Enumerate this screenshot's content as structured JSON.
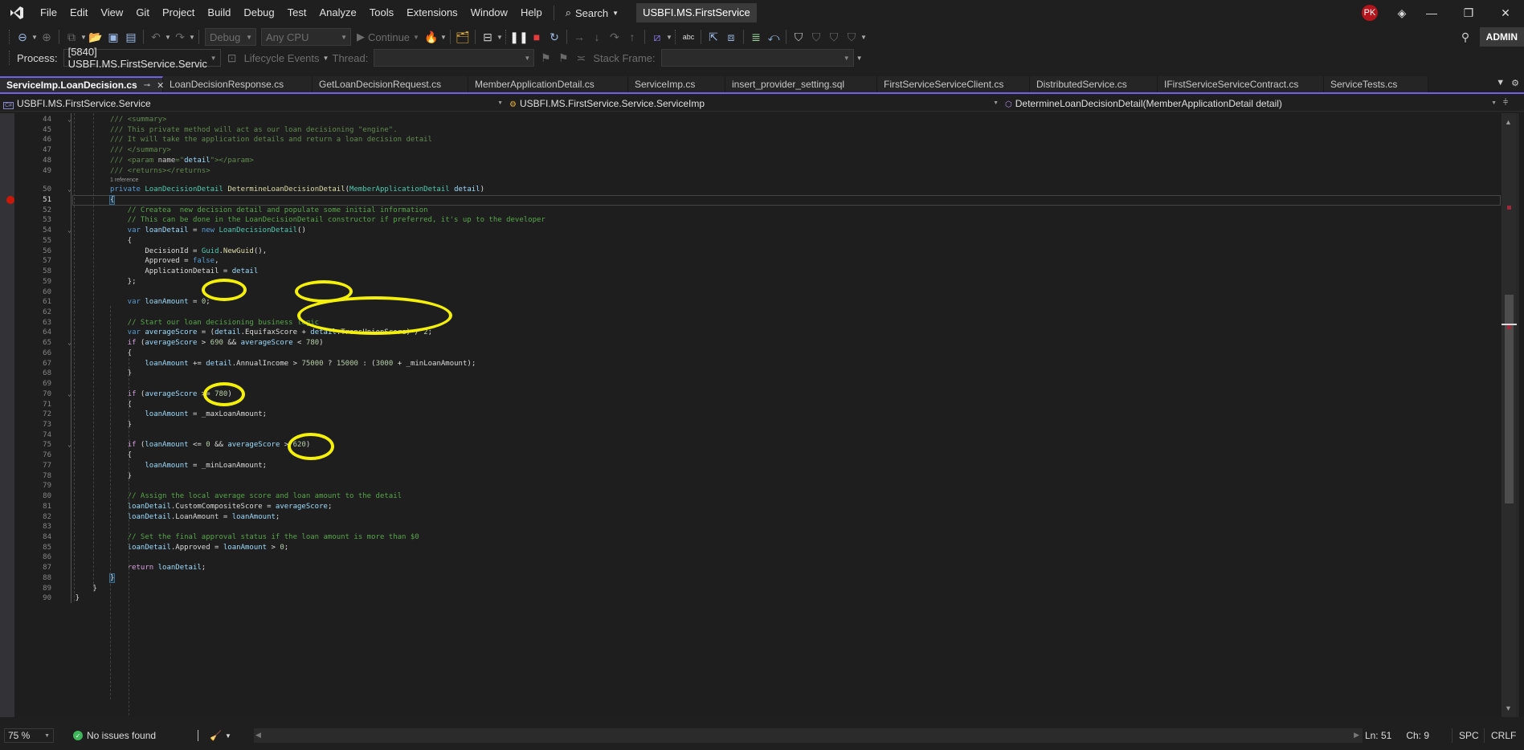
{
  "menubar": {
    "items": [
      "File",
      "Edit",
      "View",
      "Git",
      "Project",
      "Build",
      "Debug",
      "Test",
      "Analyze",
      "Tools",
      "Extensions",
      "Window",
      "Help"
    ],
    "search_label": "Search",
    "solution_name": "USBFI.MS.FirstService",
    "user_initials": "PK"
  },
  "toolbar": {
    "config": "Debug",
    "platform": "Any CPU",
    "continue_label": "Continue",
    "admin_label": "ADMIN"
  },
  "debugbar": {
    "process_label": "Process:",
    "process_value": "[5840] USBFI.MS.FirstService.Servic",
    "lifecycle_label": "Lifecycle Events",
    "thread_label": "Thread:",
    "thread_value": "",
    "stack_frame_label": "Stack Frame:",
    "stack_frame_value": ""
  },
  "tabs": [
    {
      "label": "ServiceImp.LoanDecision.cs",
      "active": true
    },
    {
      "label": "LoanDecisionResponse.cs"
    },
    {
      "label": "GetLoanDecisionRequest.cs"
    },
    {
      "label": "MemberApplicationDetail.cs"
    },
    {
      "label": "ServiceImp.cs"
    },
    {
      "label": "insert_provider_setting.sql"
    },
    {
      "label": "FirstServiceServiceClient.cs"
    },
    {
      "label": "DistributedService.cs"
    },
    {
      "label": "IFirstServiceServiceContract.cs"
    },
    {
      "label": "ServiceTests.cs"
    }
  ],
  "navbar": {
    "project": "USBFI.MS.FirstService.Service",
    "type": "USBFI.MS.FirstService.Service.ServiceImp",
    "member": "DetermineLoanDecisionDetail(MemberApplicationDetail detail)"
  },
  "editor": {
    "codelens": "1 reference",
    "current_line": 51,
    "breakpoint_line": 51,
    "line_numbers": [
      44,
      45,
      46,
      47,
      48,
      49,
      50,
      51,
      52,
      53,
      54,
      55,
      56,
      57,
      58,
      59,
      60,
      61,
      62,
      63,
      64,
      65,
      66,
      67,
      68,
      69,
      70,
      71,
      72,
      73,
      74,
      75,
      76,
      77,
      78,
      79,
      80,
      81,
      82,
      83,
      84,
      85,
      86,
      87,
      88,
      89,
      90
    ]
  },
  "code_lines": {
    "l44": "/// <summary>",
    "l45": "/// This private method will act as our loan decisioning \"engine\".",
    "l46": "/// It will take the application details and return a loan decision detail",
    "l47": "/// </summary>",
    "l48a": "/// <param ",
    "l48b": "name",
    "l48c": "=\"",
    "l48d": "detail",
    "l48e": "\"></param>",
    "l49": "/// <returns></returns>",
    "l50a": "private ",
    "l50b": "LoanDecisionDetail",
    "l50c": " DetermineLoanDecisionDetail",
    "l50d": "(",
    "l50e": "MemberApplicationDetail",
    "l50f": " detail",
    "l50g": ")",
    "l51": "{",
    "l52": "// Createa  new decision detail and populate some initial information",
    "l53": "// This can be done in the LoanDecisionDetail constructor if preferred, it's up to the developer",
    "l54a": "var ",
    "l54b": "loanDetail",
    "l54c": " = ",
    "l54d": "new ",
    "l54e": "LoanDecisionDetail",
    "l54f": "()",
    "l55": "{",
    "l56a": "DecisionId",
    "l56b": " = ",
    "l56c": "Guid",
    "l56d": ".",
    "l56e": "NewGuid",
    "l56f": "(),",
    "l57a": "Approved",
    "l57b": " = ",
    "l57c": "false",
    "l57d": ",",
    "l58a": "ApplicationDetail",
    "l58b": " = ",
    "l58c": "detail",
    "l59": "};",
    "l61a": "var ",
    "l61b": "loanAmount",
    "l61c": " = ",
    "l61d": "0",
    "l61e": ";",
    "l63": "// Start our loan decisioning business logic",
    "l64a": "var ",
    "l64b": "averageScore",
    "l64c": " = (",
    "l64d": "detail",
    "l64e": ".EquifaxScore + ",
    "l64f": "detail",
    "l64g": ".TransUnionScore) / ",
    "l64h": "2",
    "l64i": ";",
    "l65a": "if",
    "l65b": " (",
    "l65c": "averageScore",
    "l65d": " > ",
    "l65e": "690",
    "l65f": " && ",
    "l65g": "averageScore",
    "l65h": " < ",
    "l65i": "780",
    "l65j": ")",
    "l66": "{",
    "l67a": "loanAmount",
    "l67b": " += ",
    "l67c": "detail",
    "l67d": ".AnnualIncome > ",
    "l67e": "75000",
    "l67f": " ? ",
    "l67g": "15000",
    "l67h": " : (",
    "l67i": "3000",
    "l67j": " + _minLoanAmount);",
    "l68": "}",
    "l70a": "if",
    "l70b": " (",
    "l70c": "averageScore",
    "l70d": " >= ",
    "l70e": "780",
    "l70f": ")",
    "l71": "{",
    "l72a": "loanAmount",
    "l72b": " = _maxLoanAmount;",
    "l73": "}",
    "l75a": "if",
    "l75b": " (",
    "l75c": "loanAmount",
    "l75d": " <= ",
    "l75e": "0",
    "l75f": " && ",
    "l75g": "averageScore",
    "l75h": " > ",
    "l75i": "620",
    "l75j": ")",
    "l76": "{",
    "l77a": "loanAmount",
    "l77b": " = _minLoanAmount;",
    "l78": "}",
    "l80": "// Assign the local average score and loan amount to the detail",
    "l81a": "loanDetail",
    "l81b": ".CustomCompositeScore = ",
    "l81c": "averageScore",
    "l81d": ";",
    "l82a": "loanDetail",
    "l82b": ".LoanAmount = ",
    "l82c": "loanAmount",
    "l82d": ";",
    "l84": "// Set the final approval status if the loan amount is more than $0",
    "l85a": "loanDetail",
    "l85b": ".Approved = ",
    "l85c": "loanAmount",
    "l85d": " > ",
    "l85e": "0",
    "l85f": ";",
    "l87a": "return",
    "l87b": " ",
    "l87c": "loanDetail",
    "l87d": ";",
    "l88": "}",
    "l89": "}",
    "l90": "}"
  },
  "statusbar": {
    "zoom": "75 %",
    "issues": "No issues found",
    "line": "Ln: 51",
    "col": "Ch: 9",
    "whitespace": "SPC",
    "line_ending": "CRLF"
  },
  "colors": {
    "accent": "#7160e8",
    "breakpoint": "#e51400",
    "annotation": "#f5f00a"
  }
}
